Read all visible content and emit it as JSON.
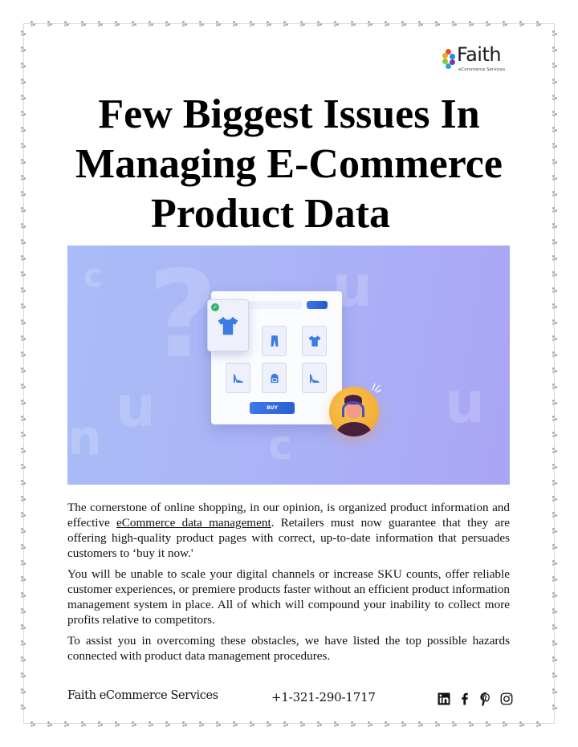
{
  "logo": {
    "wordmark": "Faith",
    "tagline": "eCommerce Services",
    "petal_colors": [
      "#e8463c",
      "#f6a623",
      "#8dc63f",
      "#2ba8c8",
      "#7d3c98",
      "#1e88e5"
    ]
  },
  "title": {
    "line1": "Few Biggest Issues In",
    "line2": "Managing E-Commerce",
    "line3": "Product Data"
  },
  "hero": {
    "buy_label": "BUY",
    "check_glyph": "✓",
    "featured_item": "tshirt-icon",
    "grid_items": [
      "pants-icon",
      "tshirt-icon",
      "heel-shoe-icon",
      "backpack-icon",
      "heel-shoe-icon"
    ],
    "accent_color": "#3d78e8",
    "background_colors": [
      "#a9bdf7",
      "#aaa5f5"
    ]
  },
  "paragraphs": {
    "p1_before": "The cornerstone of online shopping, in our opinion, is organized product information and effective ",
    "p1_link": "eCommerce data management",
    "p1_after": ". Retailers must now guarantee that they are offering high-quality product pages with correct, up-to-date information that persuades customers to ‘buy it now.'",
    "p2": "You will be unable to scale your digital channels or increase SKU counts, offer reliable customer experiences, or premiere products faster without an efficient product information management system in place. All of which will compound your inability to collect more profits relative to competitors.",
    "p3": "To assist you in overcoming these obstacles, we have listed the top possible hazards connected with product data management procedures."
  },
  "footer": {
    "company": "Faith eCommerce Services",
    "phone": "+1-321-290-1717",
    "social_icons": [
      "linkedin-icon",
      "facebook-icon",
      "pinterest-icon",
      "instagram-icon"
    ]
  }
}
